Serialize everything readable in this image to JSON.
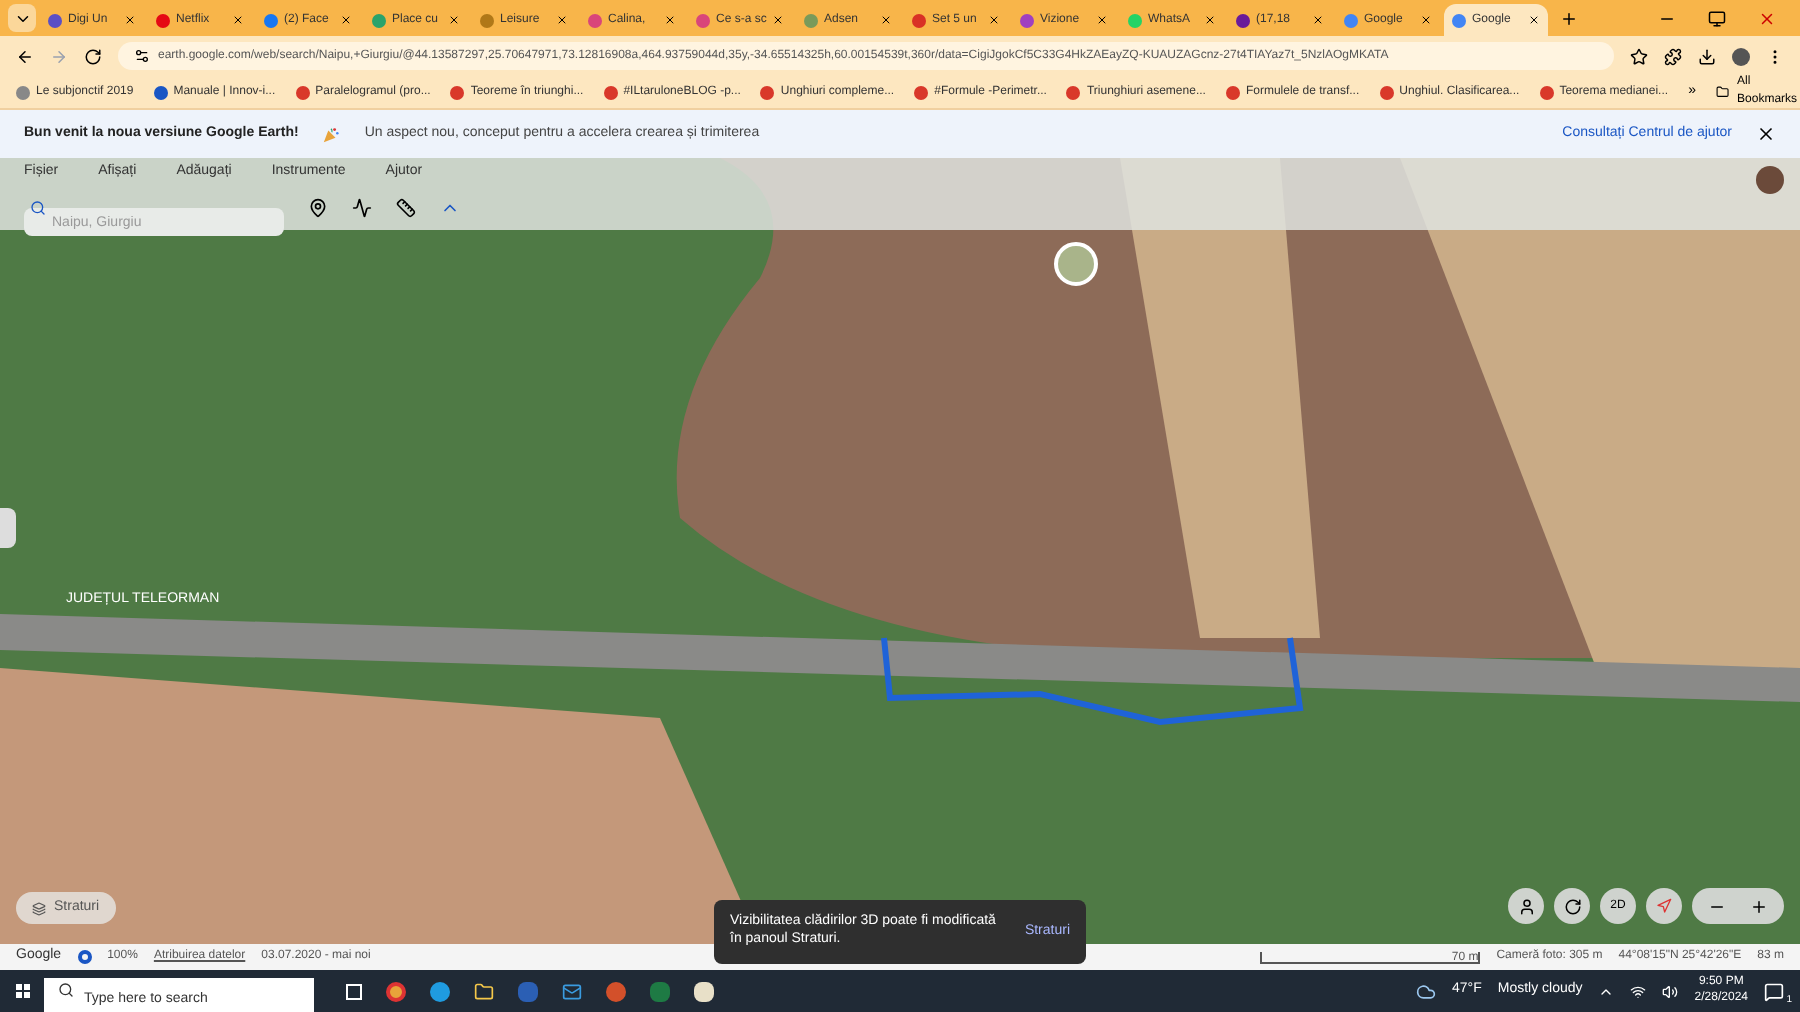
{
  "tabs": [
    {
      "label": "Digi Un",
      "color": "#5b4fc4",
      "selected": false
    },
    {
      "label": "Netflix",
      "color": "#e50914",
      "selected": false
    },
    {
      "label": "(2) Face",
      "color": "#1877f2",
      "selected": false
    },
    {
      "label": "Place cu",
      "color": "#2ba36b",
      "selected": false
    },
    {
      "label": "Leisure",
      "color": "#b07818",
      "selected": false
    },
    {
      "label": "Calina, ",
      "color": "#d9467a",
      "selected": false
    },
    {
      "label": "Ce s-a sc",
      "color": "#d9467a",
      "selected": false
    },
    {
      "label": "Adsen",
      "color": "#7a9a5a",
      "selected": false
    },
    {
      "label": "Set 5 un",
      "color": "#d93025",
      "selected": false
    },
    {
      "label": "Vizione",
      "color": "#a040c0",
      "selected": false
    },
    {
      "label": "WhatsA",
      "color": "#25d366",
      "selected": false
    },
    {
      "label": "(17,18",
      "color": "#6a1b9a",
      "selected": false
    },
    {
      "label": "Google",
      "color": "#4285f4",
      "selected": false
    },
    {
      "label": "Google",
      "color": "#4285f4",
      "selected": true
    }
  ],
  "address_bar": {
    "url": "earth.google.com/web/search/Naipu,+Giurgiu/@44.13587297,25.70647971,73.12816908a,464.93759044d,35y,-34.65514325h,60.00154539t,360r/data=CigiJgokCf5C33G4HkZAEayZQ-KUAUZAGcnz-27t4TIAYaz7t_5NzlAOgMKATA"
  },
  "bookmarks": {
    "items": [
      "Le subjonctif 2019",
      "Manuale | Innov-i...",
      "Paralelogramul (pro...",
      "Teoreme în triunghi...",
      "#ILtaruloneBLOG -p...",
      "Unghiuri compleme...",
      "#Formule -Perimetr...",
      "Triunghiuri asemene...",
      "Formulele de transf...",
      "Unghiul. Clasificarea...",
      "Teorema medianei..."
    ],
    "more": "»",
    "all": "All Bookmarks"
  },
  "banner": {
    "title": "Bun venit la noua versiune Google Earth!",
    "message": "Un aspect nou, conceput pentru a accelera crearea și trimiterea",
    "link": "Consultați Centrul de ajutor"
  },
  "menu": [
    "Fișier",
    "Afișați",
    "Adăugați",
    "Instrumente",
    "Ajutor"
  ],
  "search": {
    "placeholder": "Naipu, Giurgiu"
  },
  "map": {
    "label": "JUDEȚUL TELEORMAN",
    "layers_button": "Straturi",
    "toast": {
      "message": "Vizibilitatea clădirilor 3D poate fi modificată în panoul Straturi.",
      "action": "Straturi"
    },
    "view_button": "2D"
  },
  "status_bar": {
    "brand": "Google",
    "zoom": "100%",
    "attribution": "Atribuirea datelor",
    "date": "03.07.2020 - mai noi",
    "scale": "70 m",
    "camera": "Cameră foto: 305 m",
    "coords": "44°08'15\"N 25°42'26\"E",
    "elevation": "83 m"
  },
  "taskbar": {
    "search_placeholder": "Type here to search",
    "temperature": "47°F",
    "weather": "Mostly cloudy",
    "time": "9:50 PM",
    "date": "2/28/2024",
    "notifications": "1"
  }
}
